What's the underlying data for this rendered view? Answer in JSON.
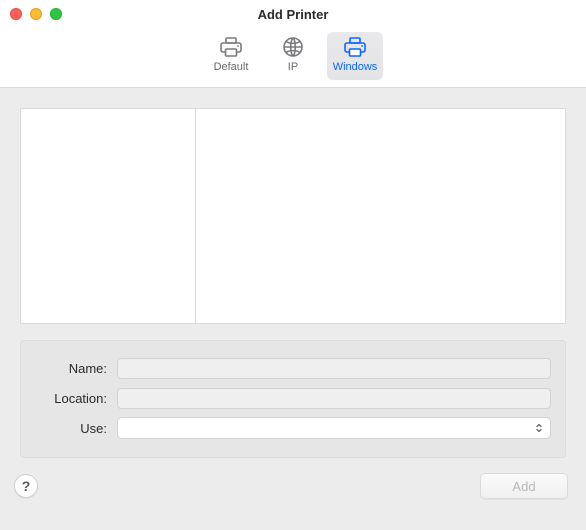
{
  "window": {
    "title": "Add Printer"
  },
  "toolbar": {
    "tabs": [
      {
        "id": "default",
        "label": "Default",
        "selected": false
      },
      {
        "id": "ip",
        "label": "IP",
        "selected": false
      },
      {
        "id": "windows",
        "label": "Windows",
        "selected": true
      }
    ]
  },
  "browser": {
    "left_items": [],
    "right_items": []
  },
  "form": {
    "name": {
      "label": "Name:",
      "value": ""
    },
    "location": {
      "label": "Location:",
      "value": ""
    },
    "use": {
      "label": "Use:",
      "value": "",
      "options": []
    }
  },
  "footer": {
    "help_symbol": "?",
    "add_label": "Add",
    "add_enabled": false
  },
  "colors": {
    "accent": "#0a66ff",
    "panel_bg": "#ececec"
  }
}
